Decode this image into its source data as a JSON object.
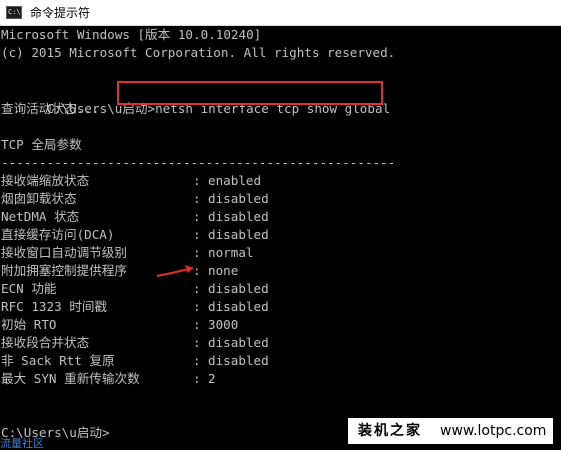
{
  "window": {
    "title": "命令提示符",
    "icon": "cmd-icon",
    "icon_glyph": "C:\\"
  },
  "console": {
    "header_line1": "Microsoft Windows [版本 10.0.10240]",
    "header_line2": "(c) 2015 Microsoft Corporation. All rights reserved.",
    "prompt1": "C:\\Users\\u启动>",
    "command": "netsh interface tcp show global",
    "querying": "查询活动状态...",
    "section_title": "TCP 全局参数",
    "divider": "----------------------------------------------------",
    "separator": ":",
    "params": [
      {
        "label": "接收端缩放状态",
        "value": "enabled"
      },
      {
        "label": "烟囱卸载状态",
        "value": "disabled"
      },
      {
        "label": "NetDMA 状态",
        "value": "disabled"
      },
      {
        "label": "直接缓存访问(DCA)",
        "value": "disabled"
      },
      {
        "label": "接收窗口自动调节级别",
        "value": "normal"
      },
      {
        "label": "附加拥塞控制提供程序",
        "value": "none"
      },
      {
        "label": "ECN 功能",
        "value": "disabled"
      },
      {
        "label": "RFC 1323 时间戳",
        "value": "disabled"
      },
      {
        "label": "初始 RTO",
        "value": "3000"
      },
      {
        "label": "接收段合并状态",
        "value": "disabled"
      },
      {
        "label": "非 Sack Rtt 复原",
        "value": "disabled"
      },
      {
        "label": "最大 SYN 重新传输次数",
        "value": "2"
      }
    ],
    "prompt2": "C:\\Users\\u启动>"
  },
  "colors": {
    "console_bg": "#000000",
    "console_text": "#c0c0c0",
    "highlight": "#e03030"
  },
  "watermark": {
    "cn": "装机之家",
    "url": "www.lotpc.com"
  },
  "corner_link": "流量社区"
}
